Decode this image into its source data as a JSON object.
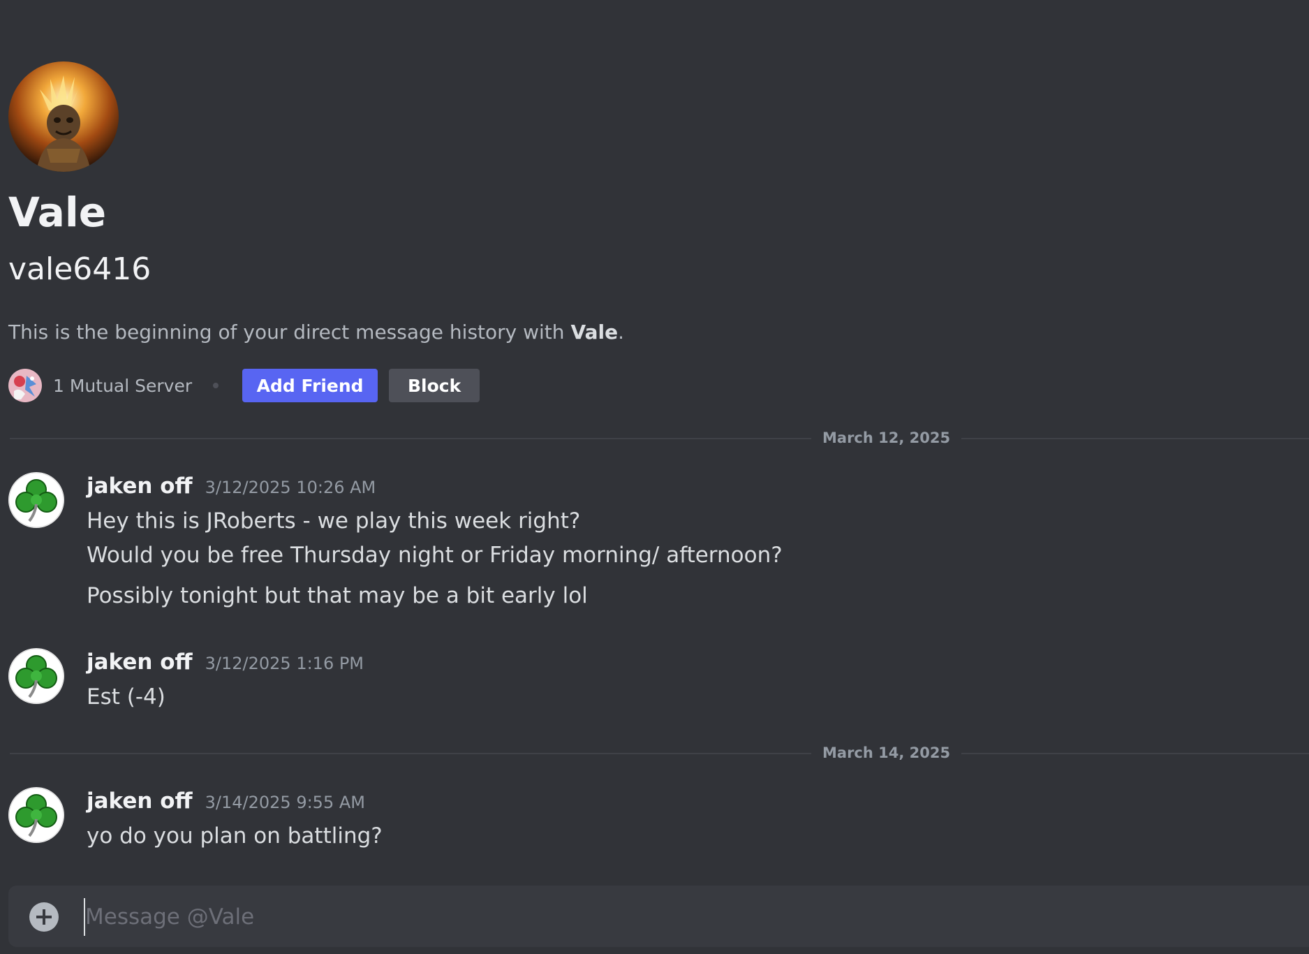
{
  "profile": {
    "display_name": "Vale",
    "username": "vale6416",
    "intro_prefix": "This is the beginning of your direct message history with ",
    "intro_name": "Vale",
    "intro_suffix": ".",
    "mutual_servers_label": "1 Mutual Server",
    "add_friend_label": "Add Friend",
    "block_label": "Block"
  },
  "dividers": [
    {
      "label": "March 12, 2025"
    },
    {
      "label": "March 14, 2025"
    }
  ],
  "messages": [
    {
      "author": "jaken off",
      "timestamp": "3/12/2025 10:26 AM",
      "lines": [
        "Hey this is JRoberts - we play this week right?",
        "Would you be free Thursday night or Friday morning/ afternoon?",
        "Possibly tonight but that may be a bit early lol"
      ]
    },
    {
      "author": "jaken off",
      "timestamp": "3/12/2025 1:16 PM",
      "lines": [
        "Est (-4)"
      ]
    },
    {
      "author": "jaken off",
      "timestamp": "3/14/2025 9:55 AM",
      "lines": [
        "yo do you plan on battling?"
      ]
    }
  ],
  "composer": {
    "placeholder": "Message @Vale",
    "value": ""
  },
  "icons": {
    "profile_avatar": "warrior-portrait-avatar",
    "server": "server-icon",
    "message_avatar": "shamrock-avatar",
    "composer_add": "plus-circle-icon"
  },
  "colors": {
    "background": "#313338",
    "primary_button": "#5865f2",
    "secondary_button": "#4e5058",
    "composer": "#383a40"
  }
}
